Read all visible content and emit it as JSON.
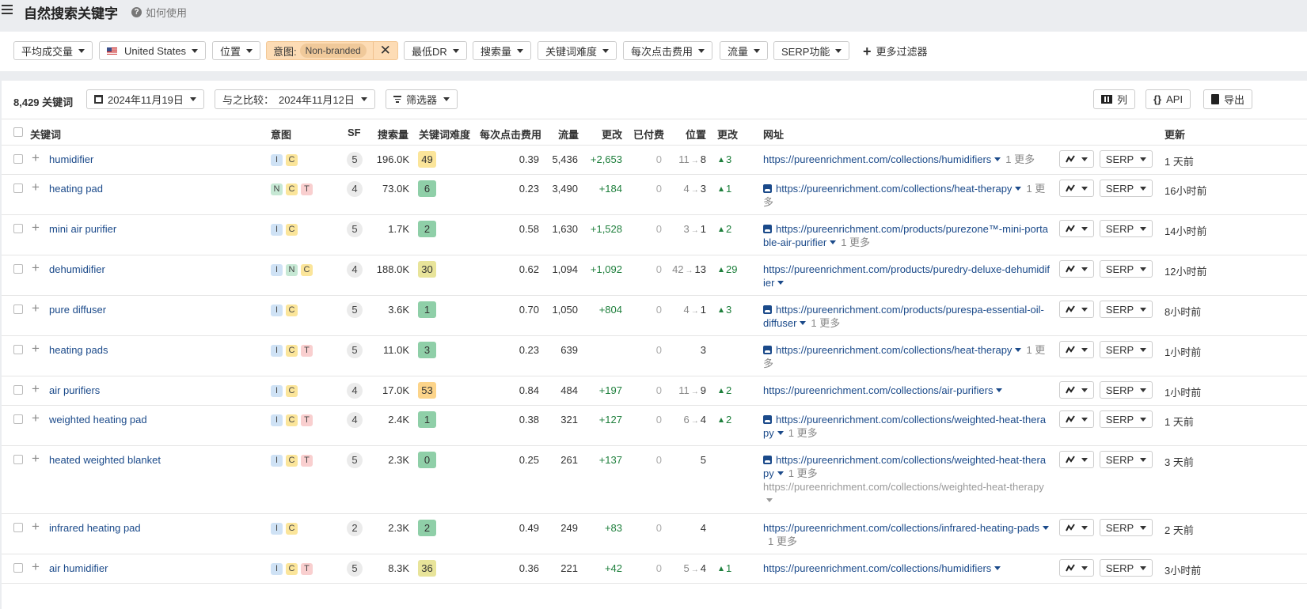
{
  "header": {
    "title": "自然搜索关键字",
    "help_label": "如何使用"
  },
  "filters": {
    "avg_volume": "平均成交量",
    "country": "United States",
    "position": "位置",
    "intent_label": "意图:",
    "intent_value": "Non-branded",
    "min_dr": "最低DR",
    "volume": "搜索量",
    "kd": "关键词难度",
    "cpc": "每次点击费用",
    "traffic": "流量",
    "serp_features": "SERP功能",
    "more_filters": "更多过滤器"
  },
  "toolbar": {
    "keyword_count": "8,429",
    "keyword_count_label": "关键词",
    "date": "2024年11月19日",
    "compare_label": "与之比较：",
    "compare_date": "2024年11月12日",
    "filter_label": "筛选器",
    "columns_label": "列",
    "api_label": "API",
    "export_label": "导出"
  },
  "columns": {
    "keyword": "关键词",
    "intent": "意图",
    "sf": "SF",
    "volume": "搜索量",
    "kd": "关键词难度",
    "cpc": "每次点击费用",
    "traffic": "流量",
    "traffic_change": "更改",
    "paid": "已付费",
    "position": "位置",
    "position_change": "更改",
    "url": "网址",
    "updated": "更新"
  },
  "colors": {
    "kd_green": "#8fcfa8",
    "kd_yellow": "#fbe59a",
    "kd_orange": "#fcd48a",
    "kd_olive": "#e8e49a",
    "positive": "#1e7f3c",
    "link": "#1b4a8a"
  },
  "rows": [
    {
      "keyword": "humidifier",
      "intents": [
        "I",
        "C"
      ],
      "sf": "5",
      "volume": "196.0K",
      "kd": "49",
      "kd_color": "#fbe59a",
      "cpc": "0.39",
      "traffic": "5,436",
      "traffic_change": "+2,653",
      "paid": "0",
      "pos_from": "11",
      "pos_to": "8",
      "pos_change": "3",
      "url_image": false,
      "url": "https://pureenrichment.com/collections/humidifiers",
      "more": "1 更多",
      "extra_url": "",
      "updated": "1 天前",
      "height": 36
    },
    {
      "keyword": "heating pad",
      "intents": [
        "N",
        "C",
        "T"
      ],
      "sf": "4",
      "volume": "73.0K",
      "kd": "6",
      "kd_color": "#8fcfa8",
      "cpc": "0.23",
      "traffic": "3,490",
      "traffic_change": "+184",
      "paid": "0",
      "pos_from": "4",
      "pos_to": "3",
      "pos_change": "1",
      "url_image": true,
      "url": "https://pureenrichment.com/collections/heat-therapy",
      "more": "1 更多",
      "extra_url": "",
      "updated": "16小时前",
      "height": 50
    },
    {
      "keyword": "mini air purifier",
      "intents": [
        "I",
        "C"
      ],
      "sf": "5",
      "volume": "1.7K",
      "kd": "2",
      "kd_color": "#8fcfa8",
      "cpc": "0.58",
      "traffic": "1,630",
      "traffic_change": "+1,528",
      "paid": "0",
      "pos_from": "3",
      "pos_to": "1",
      "pos_change": "2",
      "url_image": true,
      "url": "https://pureenrichment.com/products/purezone™-mini-portable-air-purifier",
      "more": "1 更多",
      "extra_url": "",
      "updated": "14小时前",
      "height": 50
    },
    {
      "keyword": "dehumidifier",
      "intents": [
        "I",
        "N",
        "C"
      ],
      "sf": "4",
      "volume": "188.0K",
      "kd": "30",
      "kd_color": "#e8e49a",
      "cpc": "0.62",
      "traffic": "1,094",
      "traffic_change": "+1,092",
      "paid": "0",
      "pos_from": "42",
      "pos_to": "13",
      "pos_change": "29",
      "url_image": false,
      "url": "https://pureenrichment.com/products/puredry-deluxe-dehumidifier",
      "more": "",
      "extra_url": "",
      "updated": "12小时前",
      "height": 50
    },
    {
      "keyword": "pure diffuser",
      "intents": [
        "I",
        "C"
      ],
      "sf": "5",
      "volume": "3.6K",
      "kd": "1",
      "kd_color": "#8fcfa8",
      "cpc": "0.70",
      "traffic": "1,050",
      "traffic_change": "+804",
      "paid": "0",
      "pos_from": "4",
      "pos_to": "1",
      "pos_change": "3",
      "url_image": true,
      "url": "https://pureenrichment.com/products/purespa-essential-oil-diffuser",
      "more": "1 更多",
      "extra_url": "",
      "updated": "8小时前",
      "height": 50
    },
    {
      "keyword": "heating pads",
      "intents": [
        "I",
        "C",
        "T"
      ],
      "sf": "5",
      "volume": "11.0K",
      "kd": "3",
      "kd_color": "#8fcfa8",
      "cpc": "0.23",
      "traffic": "639",
      "traffic_change": "",
      "paid": "0",
      "pos_from": "",
      "pos_to": "3",
      "pos_change": "",
      "url_image": true,
      "url": "https://pureenrichment.com/collections/heat-therapy",
      "more": "1 更多",
      "extra_url": "",
      "updated": "1小时前",
      "height": 50
    },
    {
      "keyword": "air purifiers",
      "intents": [
        "I",
        "C"
      ],
      "sf": "4",
      "volume": "17.0K",
      "kd": "53",
      "kd_color": "#fcd48a",
      "cpc": "0.84",
      "traffic": "484",
      "traffic_change": "+197",
      "paid": "0",
      "pos_from": "11",
      "pos_to": "9",
      "pos_change": "2",
      "url_image": false,
      "url": "https://pureenrichment.com/collections/air-purifiers",
      "more": "",
      "extra_url": "",
      "updated": "1小时前",
      "height": 36
    },
    {
      "keyword": "weighted heating pad",
      "intents": [
        "I",
        "C",
        "T"
      ],
      "sf": "4",
      "volume": "2.4K",
      "kd": "1",
      "kd_color": "#8fcfa8",
      "cpc": "0.38",
      "traffic": "321",
      "traffic_change": "+127",
      "paid": "0",
      "pos_from": "6",
      "pos_to": "4",
      "pos_change": "2",
      "url_image": true,
      "url": "https://pureenrichment.com/collections/weighted-heat-therapy",
      "more": "1 更多",
      "extra_url": "",
      "updated": "1 天前",
      "height": 50
    },
    {
      "keyword": "heated weighted blanket",
      "intents": [
        "I",
        "C",
        "T"
      ],
      "sf": "5",
      "volume": "2.3K",
      "kd": "0",
      "kd_color": "#8fcfa8",
      "cpc": "0.25",
      "traffic": "261",
      "traffic_change": "+137",
      "paid": "0",
      "pos_from": "",
      "pos_to": "5",
      "pos_change": "",
      "url_image": true,
      "url": "https://pureenrichment.com/collections/weighted-heat-therapy",
      "more": "1 更多",
      "extra_url": "https://pureenrichment.com/collections/weighted-heat-therapy",
      "updated": "3 天前",
      "height": 85
    },
    {
      "keyword": "infrared heating pad",
      "intents": [
        "I",
        "C"
      ],
      "sf": "2",
      "volume": "2.3K",
      "kd": "2",
      "kd_color": "#8fcfa8",
      "cpc": "0.49",
      "traffic": "249",
      "traffic_change": "+83",
      "paid": "0",
      "pos_from": "",
      "pos_to": "4",
      "pos_change": "",
      "url_image": false,
      "url": "https://pureenrichment.com/collections/infrared-heating-pads",
      "more": "1 更多",
      "extra_url": "",
      "updated": "2 天前",
      "height": 50
    },
    {
      "keyword": "air humidifier",
      "intents": [
        "I",
        "C",
        "T"
      ],
      "sf": "5",
      "volume": "8.3K",
      "kd": "36",
      "kd_color": "#e8e49a",
      "cpc": "0.36",
      "traffic": "221",
      "traffic_change": "+42",
      "paid": "0",
      "pos_from": "5",
      "pos_to": "4",
      "pos_change": "1",
      "url_image": false,
      "url": "https://pureenrichment.com/collections/humidifiers",
      "more": "",
      "extra_url": "",
      "updated": "3小时前",
      "height": 36
    }
  ],
  "serp_label": "SERP"
}
